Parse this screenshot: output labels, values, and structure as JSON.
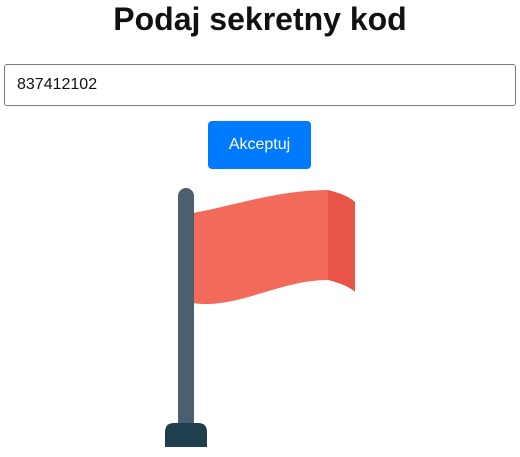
{
  "page": {
    "title": "Podaj sekretny kod"
  },
  "form": {
    "code_value": "837412102",
    "accept_label": "Akceptuj"
  },
  "colors": {
    "accent": "#007bff",
    "flag_red": "#f26a5a",
    "flag_red_dark": "#e85446",
    "pole": "#4b5f6e",
    "pole_base": "#1f3e4e"
  },
  "icons": {
    "flag": "flag-icon"
  }
}
